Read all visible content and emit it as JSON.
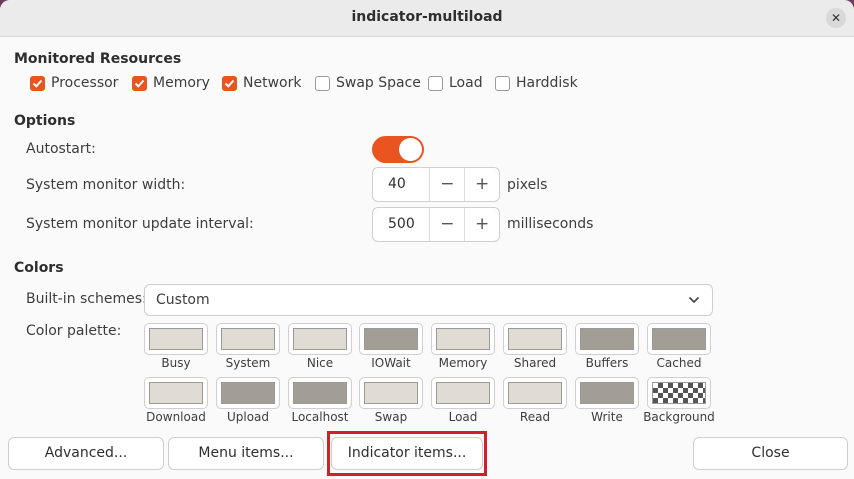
{
  "window": {
    "title": "indicator-multiload"
  },
  "monitored": {
    "heading": "Monitored Resources",
    "items": [
      {
        "label": "Processor",
        "checked": true
      },
      {
        "label": "Memory",
        "checked": true
      },
      {
        "label": "Network",
        "checked": true
      },
      {
        "label": "Swap Space",
        "checked": false
      },
      {
        "label": "Load",
        "checked": false
      },
      {
        "label": "Harddisk",
        "checked": false
      }
    ]
  },
  "options": {
    "heading": "Options",
    "autostart_label": "Autostart:",
    "autostart_on": true,
    "width_label": "System monitor width:",
    "width_value": "40",
    "width_unit": "pixels",
    "interval_label": "System monitor update interval:",
    "interval_value": "500",
    "interval_unit": "milliseconds",
    "minus": "−",
    "plus": "+"
  },
  "colors": {
    "heading": "Colors",
    "schemes_label": "Built-in schemes:",
    "schemes_value": "Custom",
    "palette_label": "Color palette:",
    "palette": [
      {
        "label": "Busy",
        "color": "#e0dcd4"
      },
      {
        "label": "System",
        "color": "#e0dcd4"
      },
      {
        "label": "Nice",
        "color": "#e0dcd4"
      },
      {
        "label": "IOWait",
        "color": "#a29e96"
      },
      {
        "label": "Memory",
        "color": "#e0dcd4"
      },
      {
        "label": "Shared",
        "color": "#e0dcd4"
      },
      {
        "label": "Buffers",
        "color": "#a29e96"
      },
      {
        "label": "Cached",
        "color": "#a29e96"
      },
      {
        "label": "Download",
        "color": "#e0dcd4"
      },
      {
        "label": "Upload",
        "color": "#a29e96"
      },
      {
        "label": "Localhost",
        "color": "#a29e96"
      },
      {
        "label": "Swap",
        "color": "#e0dcd4"
      },
      {
        "label": "Load",
        "color": "#e0dcd4"
      },
      {
        "label": "Read",
        "color": "#e0dcd4"
      },
      {
        "label": "Write",
        "color": "#a29e96"
      },
      {
        "label": "Background",
        "color": "checker"
      }
    ]
  },
  "buttons": {
    "advanced": "Advanced...",
    "menu_items": "Menu items...",
    "indicator_items": "Indicator items...",
    "close": "Close"
  },
  "accent": "#e95420"
}
